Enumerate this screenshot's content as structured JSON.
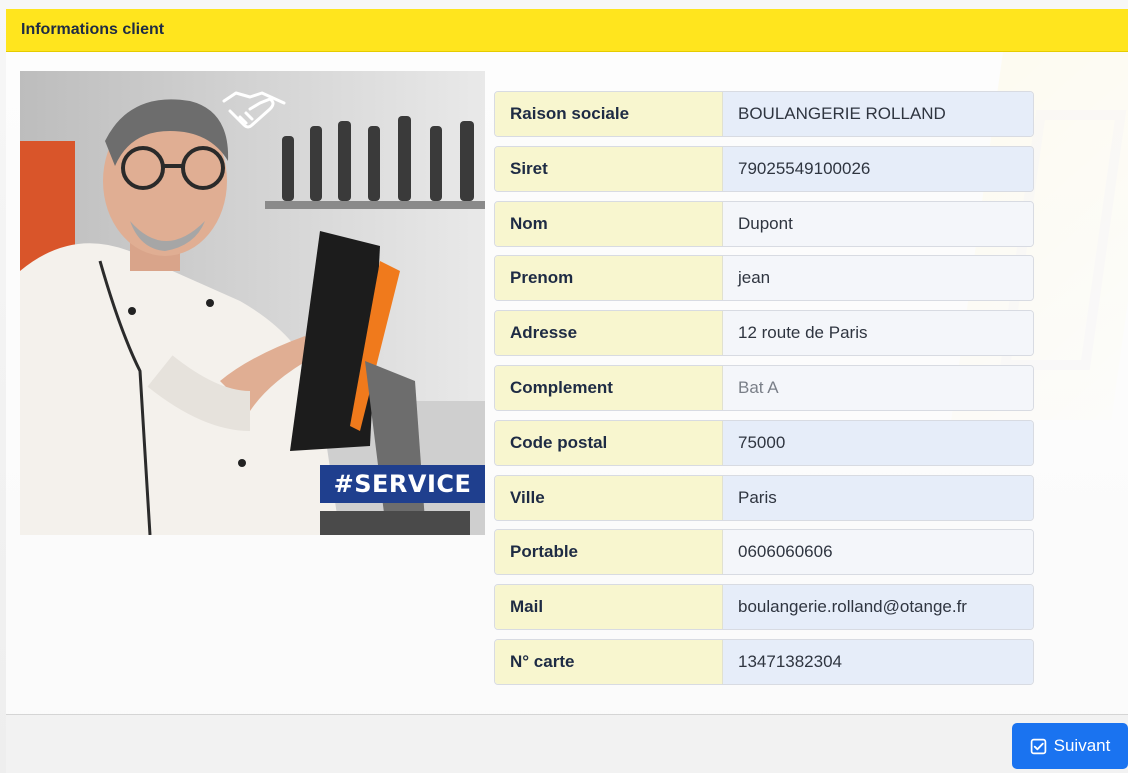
{
  "header": {
    "title": "Informations client"
  },
  "photo": {
    "tag": "#SERVICE"
  },
  "client_fields": [
    {
      "label": "Raison sociale",
      "value": "BOULANGERIE ROLLAND",
      "filled": true
    },
    {
      "label": "Siret",
      "value": "79025549100026",
      "filled": true
    },
    {
      "label": "Nom",
      "value": "Dupont",
      "filled": false
    },
    {
      "label": "Prenom",
      "value": "jean",
      "filled": false
    },
    {
      "label": "Adresse",
      "value": "12 route de Paris",
      "filled": false
    },
    {
      "label": "Complement",
      "value": "Bat A",
      "filled": false,
      "muted": true
    },
    {
      "label": "Code postal",
      "value": "75000",
      "filled": true
    },
    {
      "label": "Ville",
      "value": "Paris",
      "filled": true
    },
    {
      "label": "Portable",
      "value": "0606060606",
      "filled": false
    },
    {
      "label": "Mail",
      "value": "boulangerie.rolland@otange.fr",
      "filled": true
    },
    {
      "label": "N° carte",
      "value": "13471382304",
      "filled": true
    }
  ],
  "footer": {
    "next_label": "Suivant",
    "next_icon": "check-square-icon"
  },
  "colors": {
    "header": "#ffe51e",
    "label_bg": "#f8f6cf",
    "button": "#1a73f0",
    "tag": "#1f3f8e"
  }
}
